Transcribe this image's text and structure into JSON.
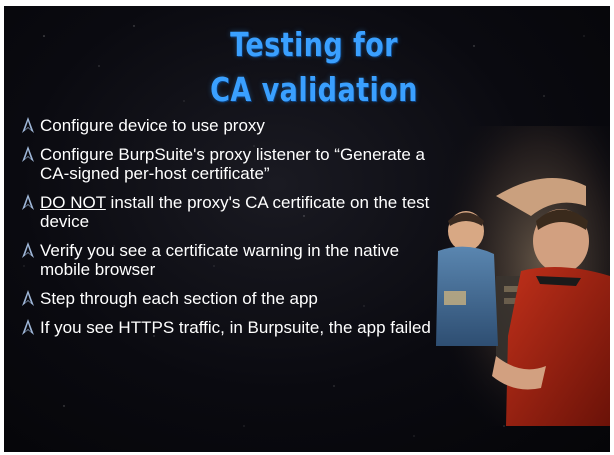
{
  "slide": {
    "title_line1": "Testing for",
    "title_line2": "CA validation",
    "bullets": [
      {
        "text": "Configure device to use proxy"
      },
      {
        "text": "Configure BurpSuite's proxy listener to “Generate a CA-signed per-host certificate”"
      },
      {
        "emphasis": "DO NOT",
        "text": "install the proxy's CA certificate on the test device"
      },
      {
        "text": "Verify you see a certificate warning in the native mobile browser"
      },
      {
        "text": "Step through each section of the app"
      },
      {
        "text": "If you see HTTPS traffic, in Burpsuite, the app failed"
      }
    ],
    "colors": {
      "title": "#3aa0ff",
      "background": "#0a0a10",
      "text": "#ffffff"
    },
    "bullet_icon": "starfleet-delta-icon",
    "photo": "star-trek-crew-photo"
  }
}
